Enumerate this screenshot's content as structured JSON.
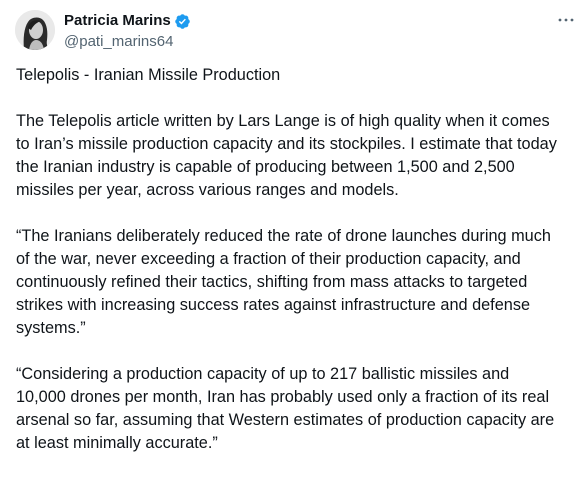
{
  "author": {
    "display_name": "Patricia Marins",
    "handle": "@pati_marins64",
    "verified": true,
    "verified_color": "#1d9bf0",
    "avatar_icon": "profile-photo-avatar"
  },
  "menu": {
    "more_icon": "more-horizontal-icon"
  },
  "tweet": {
    "title": "Telepolis - Iranian Missile Production",
    "paragraphs": [
      "The Telepolis article written by Lars Lange is of high quality when it comes\nto Iran’s missile production capacity and its stockpiles. I estimate that today\nthe Iranian industry is capable of producing between 1,500 and 2,500\nmissiles per year, across various ranges and models.",
      "“The Iranians deliberately reduced the rate of drone launches during much\nof the war, never exceeding a fraction of their production capacity, and\ncontinuously refined their tactics, shifting from mass attacks to targeted\nstrikes with increasing success rates against infrastructure and defense\nsystems.”",
      "“Considering a production capacity of up to 217 ballistic missiles and\n10,000 drones per month, Iran has probably used only a fraction of its real\narsenal so far, assuming that Western estimates of production capacity are\nat least minimally accurate.”"
    ]
  },
  "colors": {
    "text_primary": "#0f1419",
    "text_secondary": "#536471",
    "background": "#ffffff"
  }
}
